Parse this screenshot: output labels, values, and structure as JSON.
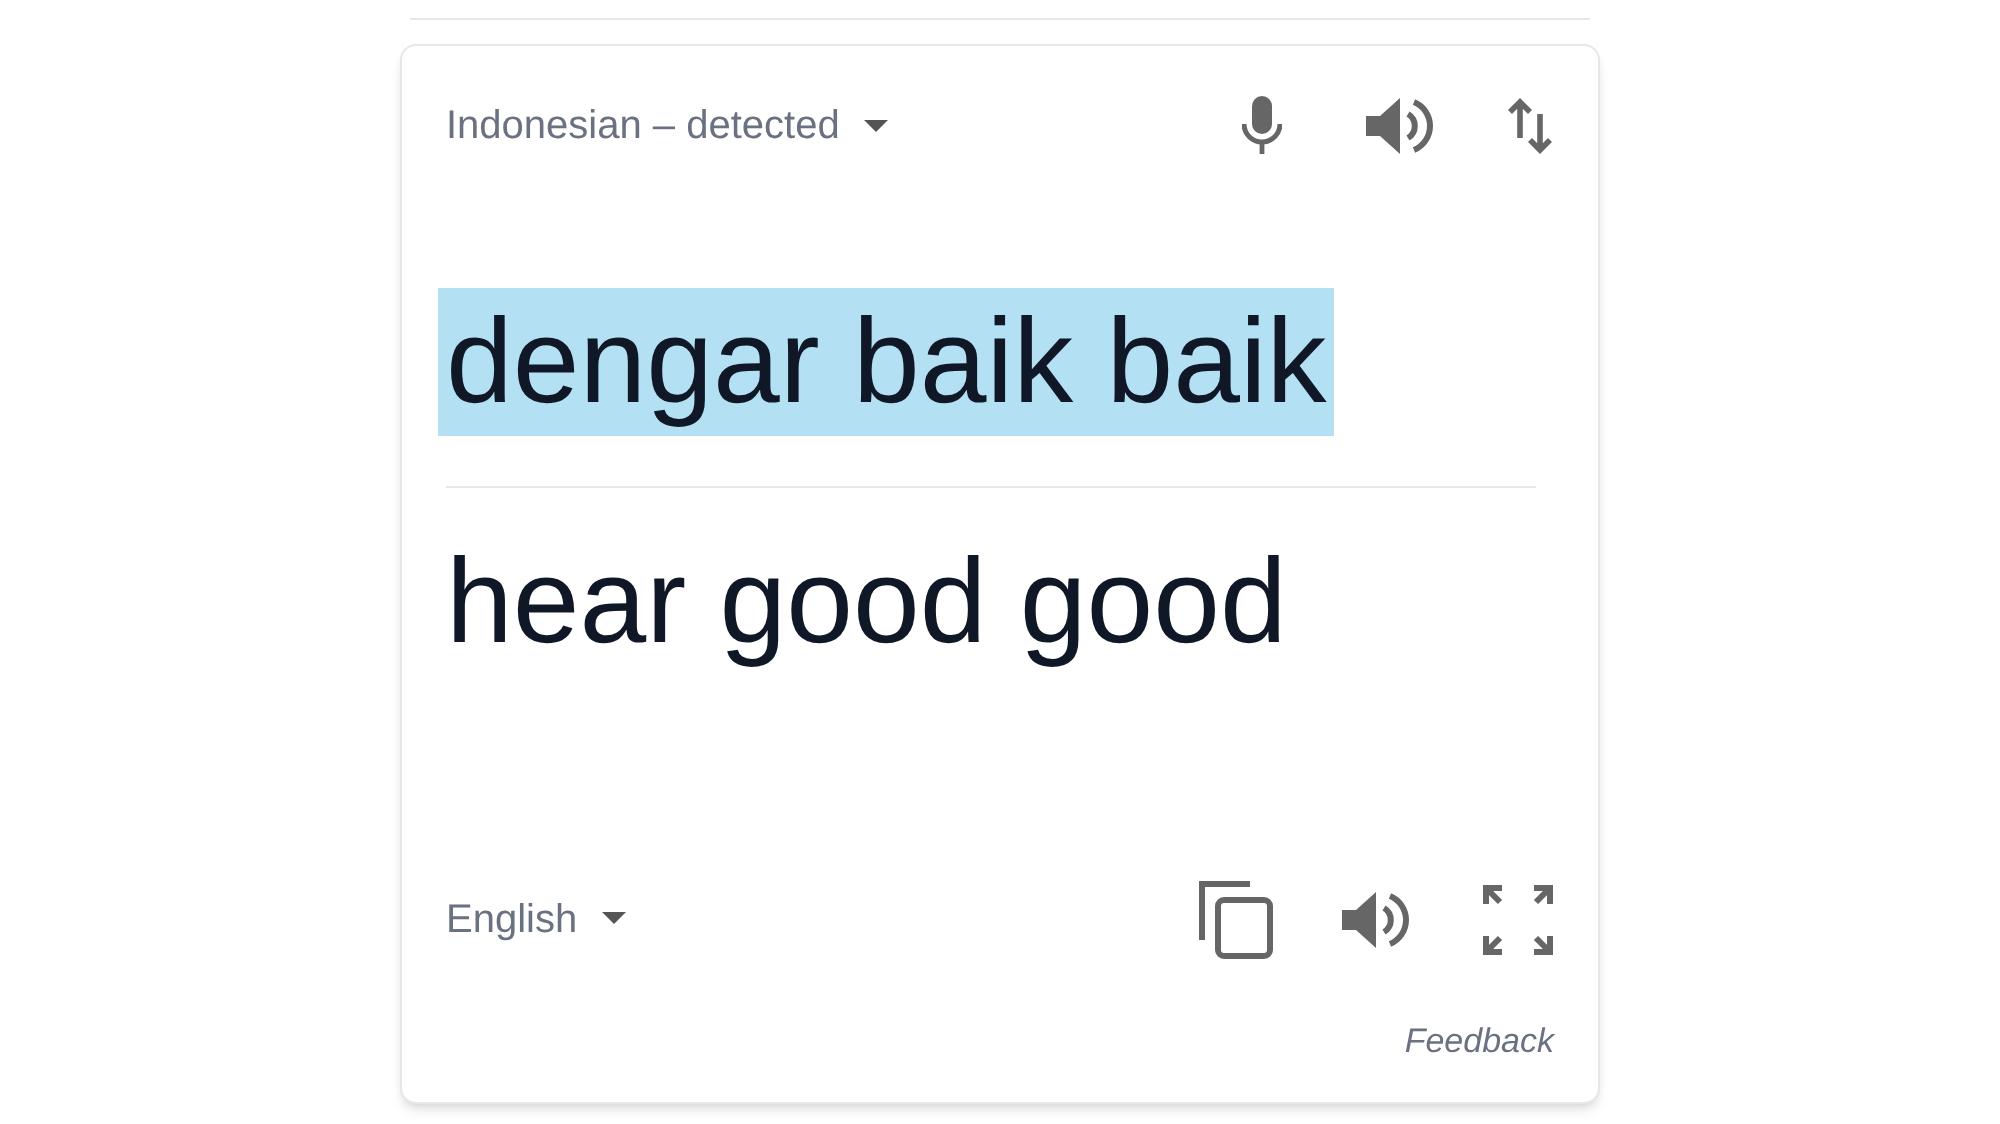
{
  "source": {
    "language": "Indonesian – detected",
    "text": "dengar baik baik",
    "highlighted": true
  },
  "translation": {
    "language": "English",
    "text": "hear good good"
  },
  "feedback": "Feedback"
}
